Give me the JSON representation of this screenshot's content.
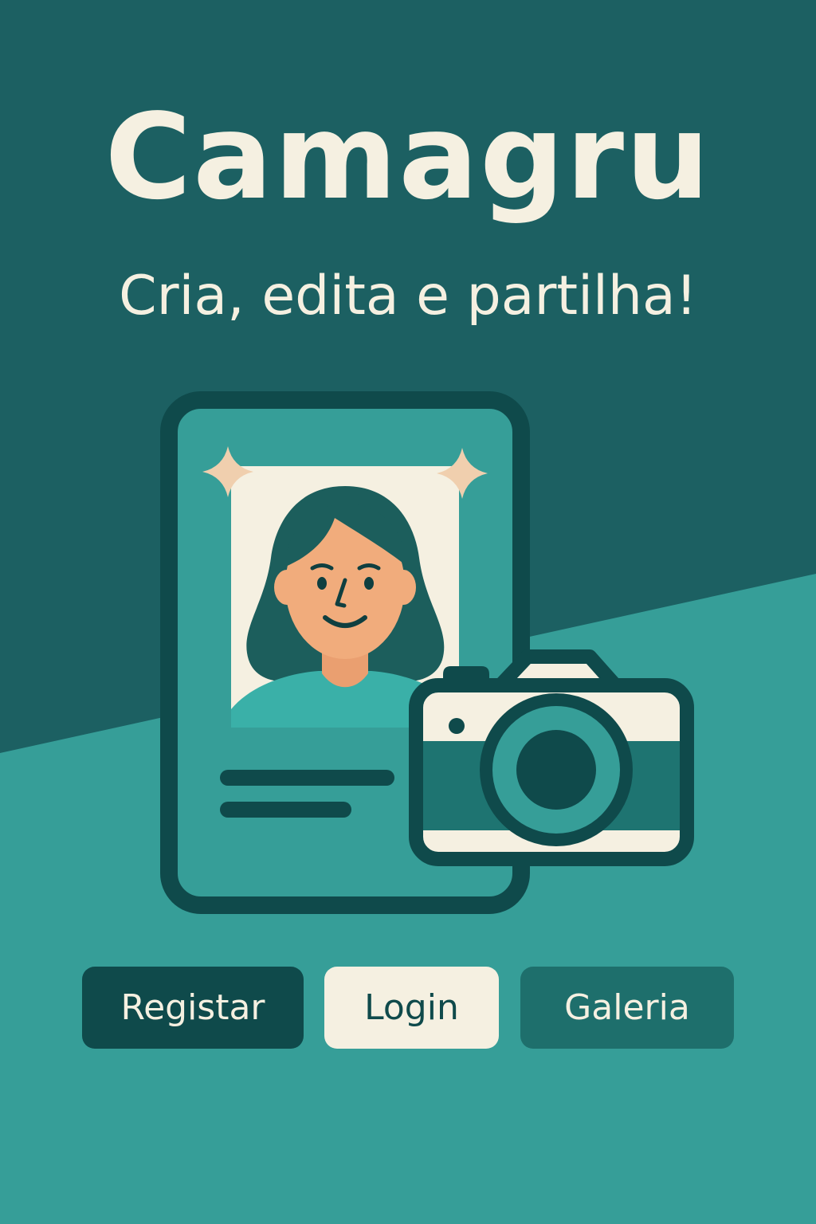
{
  "app": {
    "title": "Camagru",
    "tagline": "Cria, edita e partilha!"
  },
  "actions": {
    "register_label": "Registar",
    "login_label": "Login",
    "gallery_label": "Galeria"
  },
  "illustration": {
    "icons": [
      "phone-card-icon",
      "profile-portrait-icon",
      "sparkle-icon",
      "camera-icon"
    ]
  },
  "colors": {
    "background_dark": "#1c6062",
    "background_light": "#369e98",
    "cream": "#f5f0e1",
    "outline": "#0f4a4b",
    "button_dark": "#0f4a4b",
    "button_medium": "#1e6f6c",
    "skin": "#f1ac7c",
    "sparkle": "#f0cfae"
  }
}
